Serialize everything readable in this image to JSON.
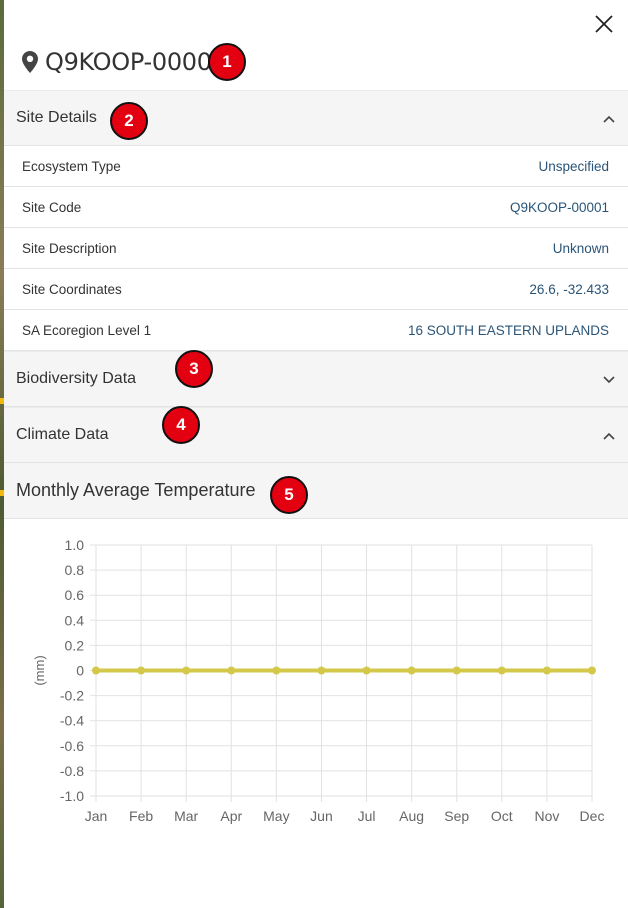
{
  "site": {
    "code": "Q9KOOP-00001"
  },
  "sections": {
    "site_details": {
      "label": "Site Details",
      "expanded": true
    },
    "biodiversity": {
      "label": "Biodiversity Data",
      "expanded": false
    },
    "climate": {
      "label": "Climate Data",
      "expanded": true
    }
  },
  "details": [
    {
      "key": "Ecosystem Type",
      "value": "Unspecified"
    },
    {
      "key": "Site Code",
      "value": "Q9KOOP-00001"
    },
    {
      "key": "Site Description",
      "value": "Unknown"
    },
    {
      "key": "Site Coordinates",
      "value": "26.6, -32.433"
    },
    {
      "key": "SA Ecoregion Level 1",
      "value": "16 SOUTH EASTERN UPLANDS"
    }
  ],
  "badges": [
    "1",
    "2",
    "3",
    "4",
    "5"
  ],
  "icons": {
    "close": "close-icon",
    "pin": "map-pin-icon",
    "chevron_up": "chevron-up-icon",
    "chevron_down": "chevron-down-icon"
  },
  "colors": {
    "accent_value": "#2a5578",
    "badge": "#e30010",
    "series_line": "#d4c84a"
  },
  "chart_data": {
    "type": "line",
    "title": "Monthly Average Temperature",
    "xlabel": "",
    "ylabel": "(mm)",
    "categories": [
      "Jan",
      "Feb",
      "Mar",
      "Apr",
      "May",
      "Jun",
      "Jul",
      "Aug",
      "Sep",
      "Oct",
      "Nov",
      "Dec"
    ],
    "series": [
      {
        "values": [
          0,
          0,
          0,
          0,
          0,
          0,
          0,
          0,
          0,
          0,
          0,
          0
        ]
      }
    ],
    "ylim": [
      -1.0,
      1.0
    ],
    "yticks": [
      "1.0",
      "0.8",
      "0.6",
      "0.4",
      "0.2",
      "0",
      "-0.2",
      "-0.4",
      "-0.6",
      "-0.8",
      "-1.0"
    ],
    "grid": true,
    "legend": "none"
  }
}
